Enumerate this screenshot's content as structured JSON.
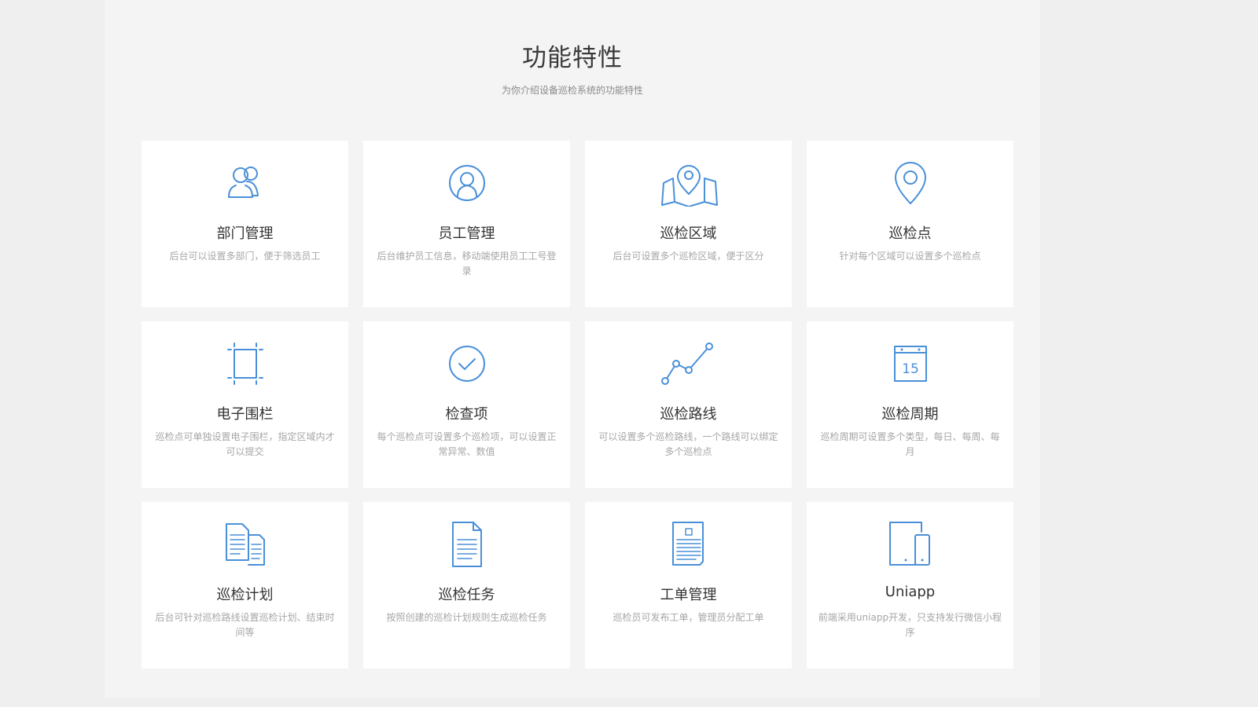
{
  "header": {
    "title": "功能特性",
    "subtitle": "为你介绍设备巡检系统的功能特性"
  },
  "features": [
    {
      "icon": "users-icon",
      "title": "部门管理",
      "desc": "后台可以设置多部门，便于筛选员工"
    },
    {
      "icon": "user-circle-icon",
      "title": "员工管理",
      "desc": "后台维护员工信息，移动端使用员工工号登录"
    },
    {
      "icon": "map-pin-map-icon",
      "title": "巡检区域",
      "desc": "后台可设置多个巡检区域，便于区分"
    },
    {
      "icon": "location-pin-icon",
      "title": "巡检点",
      "desc": "针对每个区域可以设置多个巡检点"
    },
    {
      "icon": "crop-frame-icon",
      "title": "电子围栏",
      "desc": "巡检点可单独设置电子围栏，指定区域内才可以提交"
    },
    {
      "icon": "check-circle-icon",
      "title": "检查项",
      "desc": "每个巡检点可设置多个巡检项，可以设置正常异常、数值"
    },
    {
      "icon": "route-line-icon",
      "title": "巡检路线",
      "desc": "可以设置多个巡检路线，一个路线可以绑定多个巡检点"
    },
    {
      "icon": "calendar-icon",
      "title": "巡检周期",
      "desc": "巡检周期可设置多个类型，每日、每周、每月"
    },
    {
      "icon": "documents-icon",
      "title": "巡检计划",
      "desc": "后台可针对巡检路线设置巡检计划、结束时间等"
    },
    {
      "icon": "document-icon",
      "title": "巡检任务",
      "desc": "按照创建的巡检计划规则生成巡检任务"
    },
    {
      "icon": "work-order-icon",
      "title": "工单管理",
      "desc": "巡检员可发布工单，管理员分配工单"
    },
    {
      "icon": "devices-icon",
      "title": "Uniapp",
      "desc": "前端采用uniapp开发，只支持发行微信小程序"
    }
  ],
  "calendar_day": "15",
  "colors": {
    "accent": "#4a90d9",
    "card_bg": "#ffffff",
    "page_bg": "#f4f4f4"
  }
}
